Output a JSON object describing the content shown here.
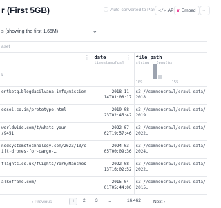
{
  "header": {
    "title": "r (First 5GB)",
    "parquet_note": "Auto-converted to Parquet",
    "api_label": "API",
    "embed_label": "Embed",
    "more_label": "⋯"
  },
  "split": {
    "label": "s (showing the first 1.65M)"
  },
  "search": {
    "label": "aset"
  },
  "columns": [
    {
      "name": "",
      "type": "k",
      "type_suffix": ""
    },
    {
      "name": "date",
      "type": "timestamp[us]",
      "type_suffix": ""
    },
    {
      "name": "file_path",
      "type": "string · ",
      "type_suffix": "lengths"
    }
  ],
  "file_path_hist": {
    "range_min": "109",
    "range_max": "155",
    "bars": [
      0.0,
      0.0,
      0.0,
      1.0,
      0.25,
      0.0,
      0.0,
      0.0
    ]
  },
  "rows": [
    {
      "url": "entketq.blogdasilvana.info/mission-",
      "date": "2018-11-\n14T01:08:17",
      "path": "s3://commoncrawl/crawl-data/\n2018…"
    },
    {
      "url": "essel.co.in/prototype.html",
      "date": "2019-08-\n23T02:45:42",
      "path": "s3://commoncrawl/crawl-data/\n2019…"
    },
    {
      "url": "worldwide.com/t/whats-your-\n/9451",
      "date": "2022-07-\n02T19:57:46",
      "path": "s3://commoncrawl/crawl-data/\n2022…"
    },
    {
      "url": "nedsystemstechnology.com/2023/10/c\nift-drones-for-cargo-…",
      "date": "2024-03-\n05T00:09:36",
      "path": "s3://commoncrawl/crawl-data/\n2024…"
    },
    {
      "url": "flights.co.uk/flights/York/Manches",
      "date": "2022-08-\n13T16:02:52",
      "path": "s3://commoncrawl/crawl-data/\n2022…"
    },
    {
      "url": "alkoffame.com/",
      "date": "2015-04-\n01T05:44:00",
      "path": "s3://commoncrawl/crawl-data/\n2015…"
    }
  ],
  "pager": {
    "prev_label": "‹ Previous",
    "pages": [
      "1",
      "2",
      "3",
      "...",
      "16,462"
    ],
    "active_page": "1",
    "next_label": "Next ›"
  }
}
